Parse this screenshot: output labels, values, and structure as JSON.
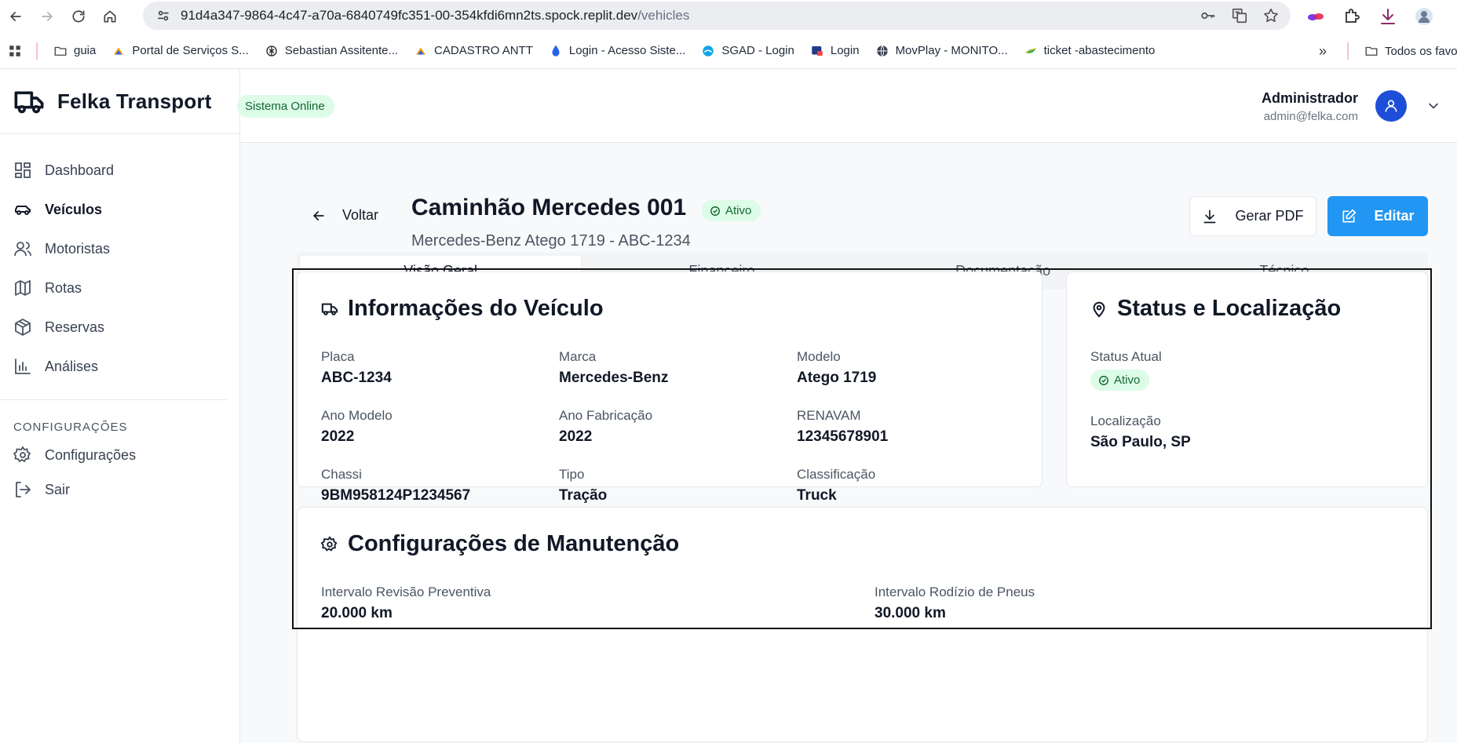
{
  "browser": {
    "url_host": "91d4a347-9864-4c47-a70a-6840749fc351-00-354kfdi6mn2ts.spock.replit.dev",
    "url_path": "/vehicles",
    "bookmarks": [
      {
        "label": "guia",
        "icon": "folder-icon"
      },
      {
        "label": "Portal de Serviços S...",
        "icon": "gov-icon"
      },
      {
        "label": "Sebastian Assitente...",
        "icon": "openai-icon"
      },
      {
        "label": "CADASTRO ANTT",
        "icon": "gov-icon"
      },
      {
        "label": "Login - Acesso Siste...",
        "icon": "drop-icon"
      },
      {
        "label": "SGAD - Login",
        "icon": "sgad-icon"
      },
      {
        "label": "Login",
        "icon": "login-icon"
      },
      {
        "label": "MovPlay - MONITO...",
        "icon": "globe-icon"
      },
      {
        "label": "ticket -abastecimento",
        "icon": "leaf-icon"
      }
    ],
    "all_bookmarks": "Todos os favo"
  },
  "app": {
    "brand": "Felka Transport",
    "online_status": "Sistema Online",
    "user": {
      "name": "Administrador",
      "email": "admin@felka.com"
    }
  },
  "sidebar": {
    "items": [
      {
        "label": "Dashboard",
        "icon": "dashboard-icon"
      },
      {
        "label": "Veículos",
        "icon": "car-icon"
      },
      {
        "label": "Motoristas",
        "icon": "users-icon"
      },
      {
        "label": "Rotas",
        "icon": "map-icon"
      },
      {
        "label": "Reservas",
        "icon": "package-icon"
      },
      {
        "label": "Análises",
        "icon": "bar-chart-icon"
      }
    ],
    "section_label": "CONFIGURAÇÕES",
    "settings": {
      "label": "Configurações",
      "icon": "gear-icon"
    },
    "logout": {
      "label": "Sair",
      "icon": "logout-icon"
    }
  },
  "vehicle": {
    "back_label": "Voltar",
    "title": "Caminhão Mercedes 001",
    "subtitle": "Mercedes-Benz Atego 1719 - ABC-1234",
    "status": "Ativo",
    "pdf_label": "Gerar PDF",
    "edit_label": "Editar",
    "tabs": [
      "Visão Geral",
      "Financeiro",
      "Documentação",
      "Técnico"
    ],
    "info": {
      "title": "Informações do Veículo",
      "fields": [
        {
          "label": "Placa",
          "value": "ABC-1234"
        },
        {
          "label": "Marca",
          "value": "Mercedes-Benz"
        },
        {
          "label": "Modelo",
          "value": "Atego 1719"
        },
        {
          "label": "Ano Modelo",
          "value": "2022"
        },
        {
          "label": "Ano Fabricação",
          "value": "2022"
        },
        {
          "label": "RENAVAM",
          "value": "12345678901"
        },
        {
          "label": "Chassi",
          "value": "9BM958124P1234567"
        },
        {
          "label": "Tipo",
          "value": "Tração"
        },
        {
          "label": "Classificação",
          "value": "Truck"
        }
      ]
    },
    "status_card": {
      "title": "Status e Localização",
      "status_label": "Status Atual",
      "status_value": "Ativo",
      "location_label": "Localização",
      "location_value": "São Paulo, SP"
    },
    "maintenance": {
      "title": "Configurações de Manutenção",
      "fields": [
        {
          "label": "Intervalo Revisão Preventiva",
          "value": "20.000 km"
        },
        {
          "label": "Intervalo Rodízio de Pneus",
          "value": "30.000 km"
        }
      ]
    }
  }
}
